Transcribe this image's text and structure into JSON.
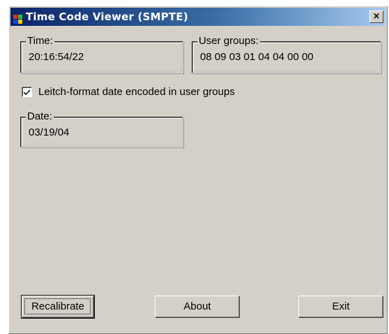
{
  "window": {
    "title": "Time Code Viewer (SMPTE)",
    "close_label": "×"
  },
  "time": {
    "label": "Time:",
    "value": "20:16:54/22"
  },
  "user_groups": {
    "label": "User groups:",
    "value": "08 09 03 01 04 04 00 00"
  },
  "leitch_checkbox": {
    "label": "Leitch-format date encoded in user groups",
    "checked": true
  },
  "date": {
    "label": "Date:",
    "value": "03/19/04"
  },
  "buttons": {
    "recalibrate": "Recalibrate",
    "about": "About",
    "exit": "Exit"
  },
  "icons": {
    "app": "tiles-app-icon",
    "close": "close-icon",
    "check": "checkmark-icon"
  },
  "colors": {
    "dialog_face": "#d4d0c8",
    "titlebar_start": "#0a246a",
    "titlebar_end": "#a6caf0"
  }
}
